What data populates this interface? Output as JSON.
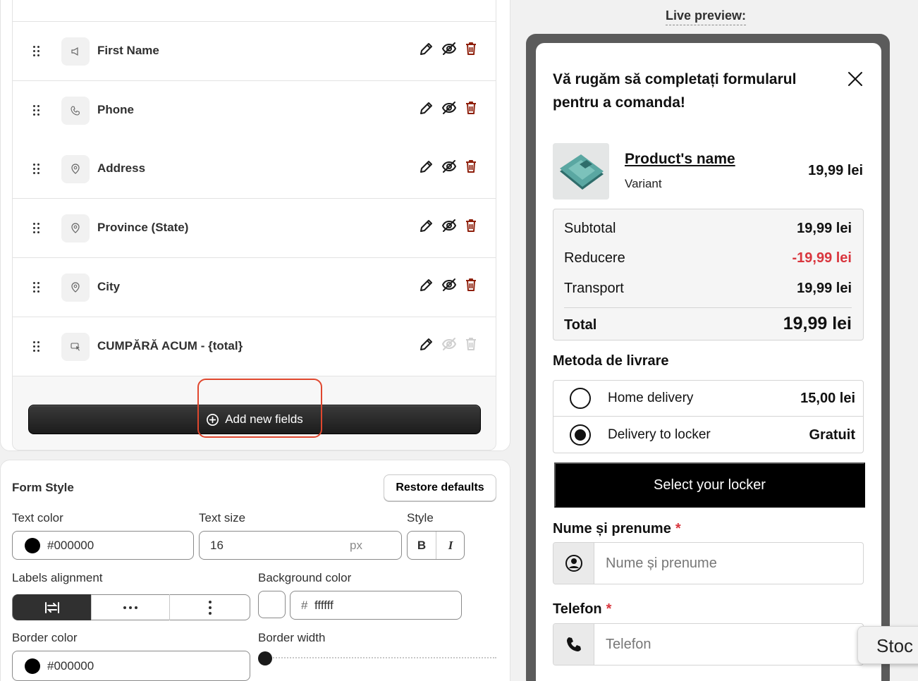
{
  "fields": [
    {
      "label": "First Name",
      "icon": "megaphone-icon",
      "active": true
    },
    {
      "label": "Phone",
      "icon": "phone-icon",
      "active": true
    },
    {
      "label": "Address",
      "icon": "location-pin-icon",
      "active": true
    },
    {
      "label": "Province (State)",
      "icon": "location-pin-icon",
      "active": true
    },
    {
      "label": "City",
      "icon": "location-pin-icon",
      "active": true
    },
    {
      "label": "CUMPĂRĂ ACUM - {total}",
      "icon": "cursor-click-icon",
      "active": false
    }
  ],
  "add_button": {
    "label": "Add new fields",
    "icon": "plus-circle-icon"
  },
  "form_style": {
    "title": "Form Style",
    "restore_label": "Restore defaults",
    "text_color_label": "Text color",
    "text_color_value": "#000000",
    "text_size_label": "Text size",
    "text_size_value": "16",
    "text_size_unit": "px",
    "style_label": "Style",
    "bold_label": "B",
    "italic_label": "I",
    "labels_alignment_label": "Labels alignment",
    "background_color_label": "Background color",
    "background_color_prefix": "#",
    "background_color_value": "ffffff",
    "border_color_label": "Border color",
    "border_color_value": "#000000",
    "border_width_label": "Border width",
    "border_width_fraction": 0.0
  },
  "preview": {
    "label": "Live preview:",
    "title": "Vă rugăm să completați formularul pentru a comanda!",
    "product": {
      "name": "Product's name",
      "variant": "Variant",
      "price": "19,99 lei"
    },
    "summary": {
      "subtotal_label": "Subtotal",
      "subtotal_value": "19,99 lei",
      "discount_label": "Reducere",
      "discount_value": "-19,99 lei",
      "shipping_label": "Transport",
      "shipping_value": "19,99 lei",
      "total_label": "Total",
      "total_value": "19,99 lei"
    },
    "delivery": {
      "title": "Metoda de livrare",
      "options": [
        {
          "label": "Home delivery",
          "price": "15,00 lei",
          "selected": false
        },
        {
          "label": "Delivery to locker",
          "price": "Gratuit",
          "selected": true
        }
      ],
      "locker_button": "Select your locker"
    },
    "name_field": {
      "label": "Nume și prenume",
      "required": "*",
      "placeholder": "Nume și prenume"
    },
    "phone_field": {
      "label": "Telefon",
      "required": "*",
      "placeholder": "Telefon"
    },
    "tooltip": "Stoc"
  },
  "colors": {
    "accent": "#1c1c1c",
    "danger": "#8e1f0b",
    "discount": "#d9363e",
    "highlight": "#e0472e"
  }
}
